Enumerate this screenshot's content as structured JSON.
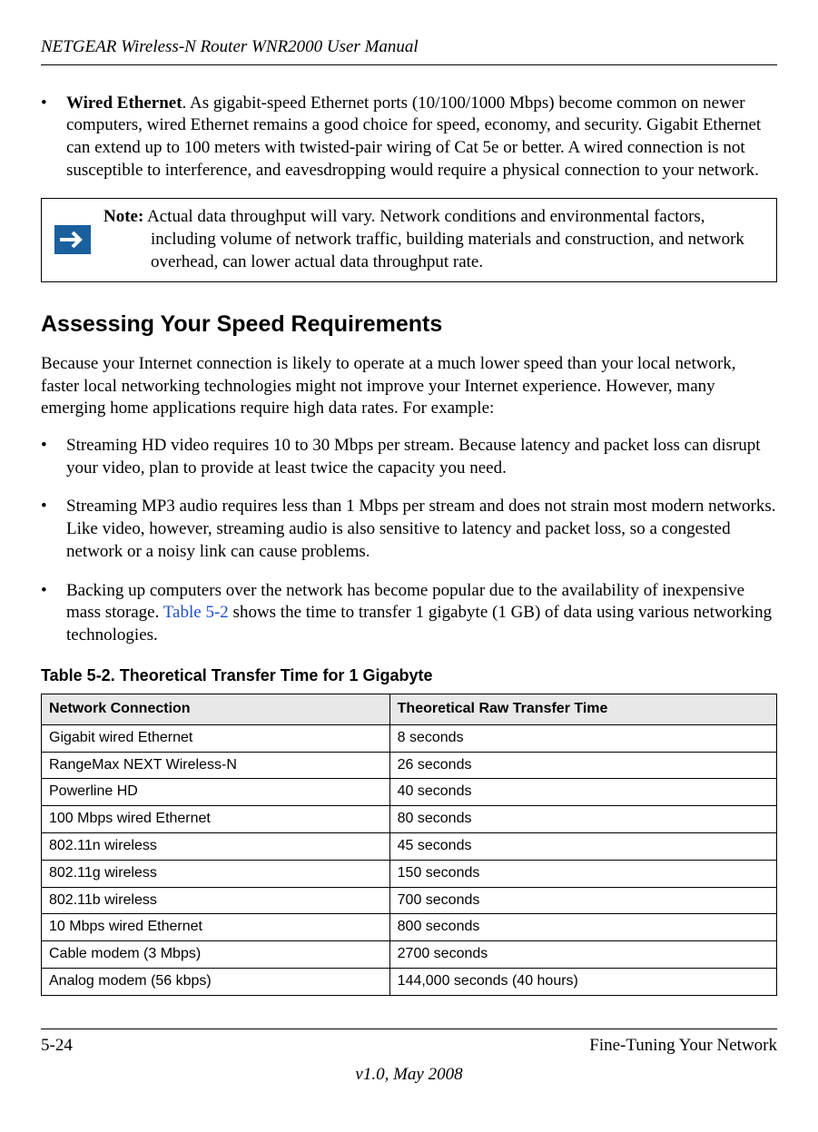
{
  "header": {
    "title": "NETGEAR Wireless-N Router WNR2000 User Manual"
  },
  "wired_ethernet": {
    "bullet": "•",
    "label": "Wired Ethernet",
    "text": ". As gigabit-speed Ethernet ports (10/100/1000 Mbps) become common on newer computers, wired Ethernet remains a good choice for speed, economy, and security. Gigabit Ethernet can extend up to 100 meters with twisted-pair wiring of Cat 5e or better. A wired connection is not susceptible to interference, and eavesdropping would require a physical connection to your network."
  },
  "note": {
    "label": "Note:",
    "text": " Actual data throughput will vary. Network conditions and environmental factors, including volume of network traffic, building materials and construction, and network overhead, can lower actual data throughput rate."
  },
  "section": {
    "title": "Assessing Your Speed Requirements"
  },
  "intro": "Because your Internet connection is likely to operate at a much lower speed than your local network, faster local networking technologies might not improve your Internet experience. However, many emerging home applications require high data rates. For example:",
  "bullets": [
    {
      "marker": "•",
      "text": "Streaming HD video requires 10 to 30 Mbps per stream. Because latency and packet loss can disrupt your video, plan to provide at least twice the capacity you need."
    },
    {
      "marker": "•",
      "text": "Streaming MP3 audio requires less than 1 Mbps per stream and does not strain most modern networks. Like video, however, streaming audio is also sensitive to latency and packet loss, so a congested network or a noisy link can cause problems."
    },
    {
      "marker": "•",
      "pre": "Backing up computers over the network has become popular due to the availability of inexpensive mass storage. ",
      "link": "Table 5-2",
      "post": " shows the time to transfer 1 gigabyte (1 GB) of data using various networking technologies."
    }
  ],
  "table": {
    "caption": "Table 5-2.   Theoretical Transfer Time for 1 Gigabyte",
    "headers": [
      "Network Connection",
      "Theoretical Raw Transfer Time"
    ],
    "rows": [
      [
        "Gigabit wired Ethernet",
        "8 seconds"
      ],
      [
        "RangeMax NEXT Wireless-N",
        "26 seconds"
      ],
      [
        "Powerline HD",
        "40 seconds"
      ],
      [
        "100 Mbps wired Ethernet",
        "80 seconds"
      ],
      [
        "802.11n wireless",
        "45 seconds"
      ],
      [
        "802.11g wireless",
        "150 seconds"
      ],
      [
        "802.11b wireless",
        "700 seconds"
      ],
      [
        "10 Mbps wired Ethernet",
        "800 seconds"
      ],
      [
        "Cable modem (3 Mbps)",
        "2700 seconds"
      ],
      [
        "Analog modem (56 kbps)",
        "144,000 seconds (40 hours)"
      ]
    ]
  },
  "footer": {
    "left": "5-24",
    "right": "Fine-Tuning Your Network",
    "version": "v1.0, May 2008"
  },
  "chart_data": {
    "type": "table",
    "title": "Theoretical Transfer Time for 1 Gigabyte",
    "columns": [
      "Network Connection",
      "Theoretical Raw Transfer Time"
    ],
    "rows": [
      {
        "connection": "Gigabit wired Ethernet",
        "time": "8 seconds"
      },
      {
        "connection": "RangeMax NEXT Wireless-N",
        "time": "26 seconds"
      },
      {
        "connection": "Powerline HD",
        "time": "40 seconds"
      },
      {
        "connection": "100 Mbps wired Ethernet",
        "time": "80 seconds"
      },
      {
        "connection": "802.11n wireless",
        "time": "45 seconds"
      },
      {
        "connection": "802.11g wireless",
        "time": "150 seconds"
      },
      {
        "connection": "802.11b wireless",
        "time": "700 seconds"
      },
      {
        "connection": "10 Mbps wired Ethernet",
        "time": "800 seconds"
      },
      {
        "connection": "Cable modem (3 Mbps)",
        "time": "2700 seconds"
      },
      {
        "connection": "Analog modem (56 kbps)",
        "time": "144,000 seconds (40 hours)"
      }
    ]
  }
}
